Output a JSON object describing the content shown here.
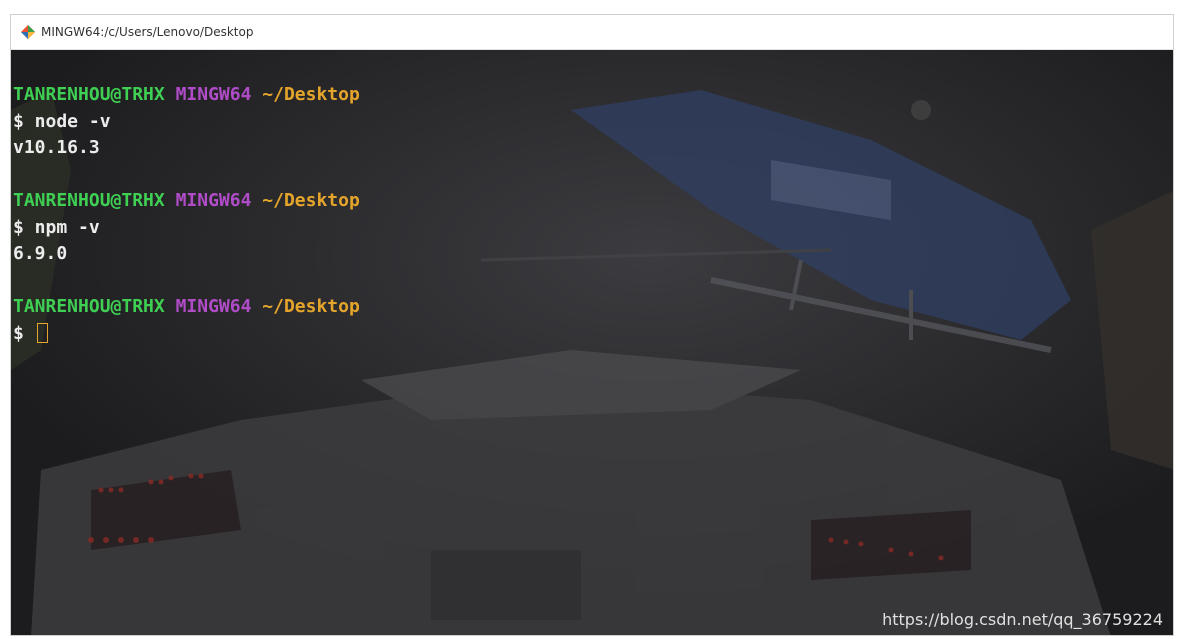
{
  "window": {
    "title": "MINGW64:/c/Users/Lenovo/Desktop",
    "icon": "git-diamond-icon"
  },
  "terminal": {
    "colors": {
      "user": "#3fcf53",
      "host": "#b04cc8",
      "path": "#e5a52a",
      "text": "#ececec",
      "background": "#202022"
    },
    "blocks": [
      {
        "prompt": {
          "user": "TANRENHOU@TRHX",
          "host": "MINGW64",
          "path": "~/Desktop"
        },
        "command": "$ node -v",
        "output": "v10.16.3"
      },
      {
        "prompt": {
          "user": "TANRENHOU@TRHX",
          "host": "MINGW64",
          "path": "~/Desktop"
        },
        "command": "$ npm -v",
        "output": "6.9.0"
      },
      {
        "prompt": {
          "user": "TANRENHOU@TRHX",
          "host": "MINGW64",
          "path": "~/Desktop"
        },
        "command": "$"
      }
    ]
  },
  "watermark": "https://blog.csdn.net/qq_36759224"
}
